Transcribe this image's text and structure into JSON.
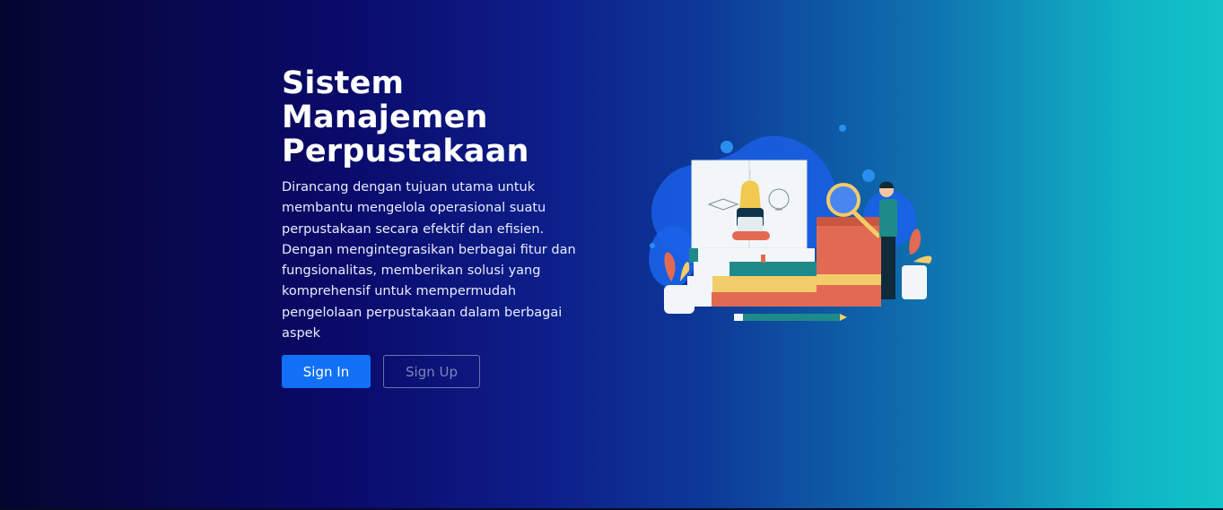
{
  "hero": {
    "title_lines": [
      "Sistem",
      "Manajemen",
      "Perpustakaan"
    ],
    "description_lines": [
      "Dirancang dengan tujuan utama untuk",
      "membantu mengelola operasional suatu",
      "perpustakaan secara efektif dan efisien.",
      "Dengan mengintegrasikan berbagai fitur dan",
      "fungsionalitas, memberikan solusi yang",
      "komprehensif untuk mempermudah",
      "pengelolaan perpustakaan dalam berbagai",
      "aspek"
    ],
    "signin_label": "Sign In",
    "signup_label": "Sign Up"
  },
  "illustration": {
    "name": "library-books-illustration",
    "colors": {
      "blob": "#1a63e8",
      "book_red": "#e26a52",
      "book_teal": "#1e8a8a",
      "book_yellow": "#f3cc6a",
      "paper": "#f3f6f8",
      "figure_dark": "#0f2a3a"
    }
  },
  "colors": {
    "primary_button": "#1170f6",
    "outline_button_border": "#6a74a8",
    "gradient_start": "#050530",
    "gradient_end": "#12c4c8"
  }
}
